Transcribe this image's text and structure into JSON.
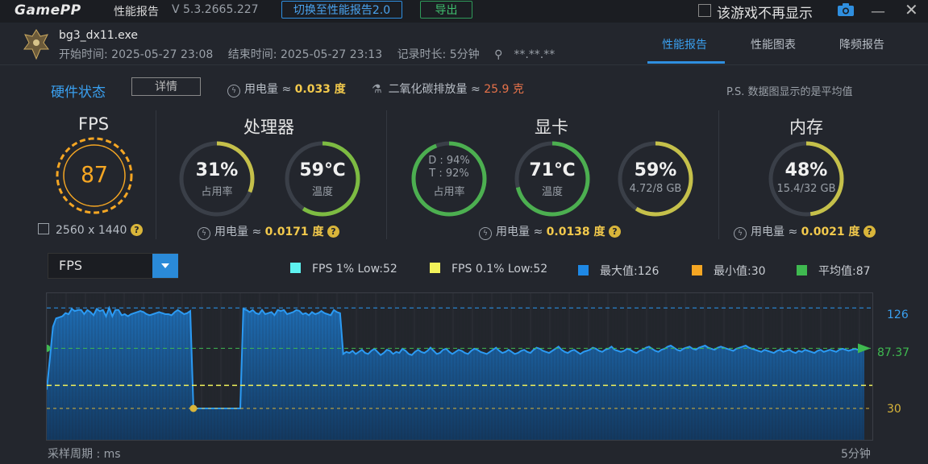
{
  "titlebar": {
    "logo_a": "Game",
    "logo_b": "PP",
    "title": "性能报告",
    "version": "V 5.3.2665.227",
    "switch_button": "切换至性能报告2.0",
    "export_button": "导出",
    "hide_label": "该游戏不再显示"
  },
  "header": {
    "exe_name": "bg3_dx11.exe",
    "start_time": "开始时间: 2025-05-27 23:08",
    "end_time": "结束时间: 2025-05-27 23:13",
    "record_duration": "记录时长: 5分钟",
    "location": "**.**.**",
    "tabs": [
      "性能报告",
      "性能图表",
      "降频报告"
    ]
  },
  "hardware": {
    "title": "硬件状态",
    "detail_button": "详情",
    "power_label": "用电量 ≈ ",
    "power_value": "0.033 度",
    "co2_label": "二氧化碳排放量 ≈ ",
    "co2_value": "25.9 克",
    "note": "P.S. 数据图显示的是平均值"
  },
  "fps": {
    "title": "FPS",
    "value": "87",
    "resolution": "2560 x 1440"
  },
  "cpu": {
    "title": "处理器",
    "usage": "31%",
    "usage_label": "占用率",
    "usage_fraction": 0.31,
    "temp": "59℃",
    "temp_label": "温度",
    "temp_fraction": 0.59,
    "power_label": "用电量 ≈ ",
    "power_value": "0.0171 度"
  },
  "gpu": {
    "title": "显卡",
    "d_usage": "D : 94%",
    "t_usage": "T : 92%",
    "usage_label": "占用率",
    "usage_fraction": 0.94,
    "temp": "71℃",
    "temp_label": "温度",
    "temp_fraction": 0.71,
    "vram": "59%",
    "vram_detail": "4.72/8 GB",
    "vram_fraction": 0.59,
    "power_label": "用电量 ≈ ",
    "power_value": "0.0138 度"
  },
  "memory": {
    "title": "内存",
    "usage": "48%",
    "detail": "15.4/32 GB",
    "usage_fraction": 0.48,
    "power_label": "用电量 ≈ ",
    "power_value": "0.0021 度"
  },
  "chart_controls": {
    "metric": "FPS",
    "legend": [
      {
        "label": "FPS 1% Low:52",
        "color": "#5ef2f0"
      },
      {
        "label": "FPS 0.1% Low:52",
        "color": "#f2f25a"
      },
      {
        "label": "最大值:126",
        "color": "#1e88e5"
      },
      {
        "label": "最小值:30",
        "color": "#f5a623"
      },
      {
        "label": "平均值:87",
        "color": "#3fb950"
      }
    ],
    "sample_label": "采样周期 : ms",
    "duration_label": "5分钟"
  },
  "chart_data": {
    "type": "area",
    "series": [
      {
        "name": "FPS",
        "values": [
          48,
          78,
          108,
          116,
          117,
          118,
          121,
          120,
          125,
          123,
          124,
          124,
          120,
          124,
          122,
          119,
          125,
          123,
          124,
          118,
          126,
          118,
          124,
          124,
          119,
          120,
          118,
          120,
          121,
          122,
          123,
          122,
          120,
          119,
          120,
          121,
          122,
          121,
          120,
          120,
          119,
          122,
          124,
          122,
          120,
          121,
          123,
          30,
          30,
          30,
          30,
          30,
          30,
          30,
          30,
          30,
          30,
          30,
          30,
          30,
          30,
          30,
          30,
          125,
          124,
          122,
          124,
          121,
          120,
          124,
          120,
          121,
          122,
          119,
          124,
          123,
          124,
          120,
          121,
          122,
          124,
          123,
          120,
          121,
          119,
          122,
          120,
          121,
          123,
          121,
          120,
          119,
          124,
          122,
          121,
          82,
          84,
          83,
          85,
          82,
          84,
          86,
          83,
          82,
          85,
          87,
          84,
          81,
          83,
          86,
          85,
          82,
          84,
          83,
          87,
          85,
          82,
          81,
          84,
          86,
          84,
          83,
          85,
          88,
          85,
          82,
          83,
          86,
          87,
          84,
          82,
          84,
          86,
          85,
          83,
          82,
          85,
          87,
          86,
          84,
          83,
          82,
          84,
          86,
          88,
          85,
          83,
          84,
          86,
          84,
          82,
          83,
          85,
          86,
          84,
          83,
          86,
          88,
          87,
          85,
          84,
          83,
          85,
          87,
          89,
          86,
          84,
          83,
          85,
          86,
          84,
          82,
          84,
          85,
          86,
          88,
          87,
          85,
          84,
          86,
          87,
          89,
          86,
          85,
          84,
          85,
          87,
          86,
          84,
          83,
          85,
          86,
          88,
          89,
          87,
          85,
          84,
          86,
          87,
          89,
          90,
          88,
          86,
          85,
          87,
          88,
          89,
          87,
          86,
          88,
          89,
          90,
          88,
          87,
          86,
          88,
          89,
          88,
          87,
          86,
          85,
          87,
          88,
          89,
          90,
          88,
          87,
          86,
          85,
          84,
          86,
          85,
          84,
          83,
          85,
          86,
          84,
          85,
          86,
          84,
          83,
          85,
          84,
          86,
          85,
          84,
          83,
          85,
          86,
          84,
          85,
          86,
          85,
          84,
          86,
          87,
          86,
          85,
          86,
          87,
          86,
          89,
          87
        ]
      }
    ],
    "ylim": [
      0,
      140
    ],
    "reference_lines": {
      "max": 126,
      "min": 30,
      "avg": 87.37,
      "low_1pct": 52,
      "low_01pct": 52
    },
    "y_tick_labels": [
      "126",
      "87.37",
      "30"
    ],
    "grid": true
  }
}
